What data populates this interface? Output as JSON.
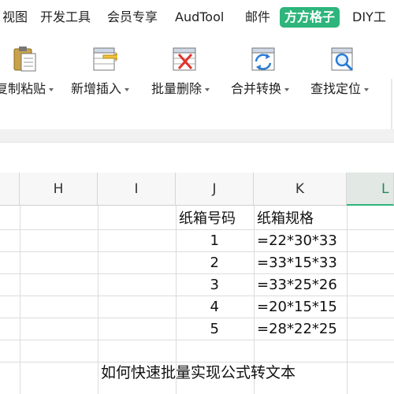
{
  "tabs": [
    "视图",
    "开发工具",
    "会员专享",
    "AudTool",
    "邮件",
    "方方格子",
    "DIY工"
  ],
  "active_tab": "方方格子",
  "ribbon": {
    "groups": [
      {
        "label": "复制粘贴",
        "icon": "clipboard-paste-icon"
      },
      {
        "label": "新增插入",
        "icon": "insert-rows-icon"
      },
      {
        "label": "批量删除",
        "icon": "batch-delete-icon"
      },
      {
        "label": "合并转换",
        "icon": "merge-convert-icon"
      },
      {
        "label": "查找定位",
        "icon": "find-locate-icon"
      }
    ]
  },
  "sheet": {
    "columns": [
      "H",
      "I",
      "J",
      "K",
      "L"
    ],
    "selected_column": "L",
    "headers": {
      "J": "纸箱号码",
      "K": "纸箱规格"
    },
    "rows": [
      {
        "J": "1",
        "K": "=22*30*33"
      },
      {
        "J": "2",
        "K": "=33*15*33"
      },
      {
        "J": "3",
        "K": "=33*25*26"
      },
      {
        "J": "4",
        "K": "=20*15*15"
      },
      {
        "J": "5",
        "K": "=28*22*25"
      }
    ],
    "caption": "如何快速批量实现公式转文本"
  },
  "colors": {
    "accent": "#2db57b",
    "grid": "#dcdcdc",
    "header_bg": "#f7f7f7"
  }
}
